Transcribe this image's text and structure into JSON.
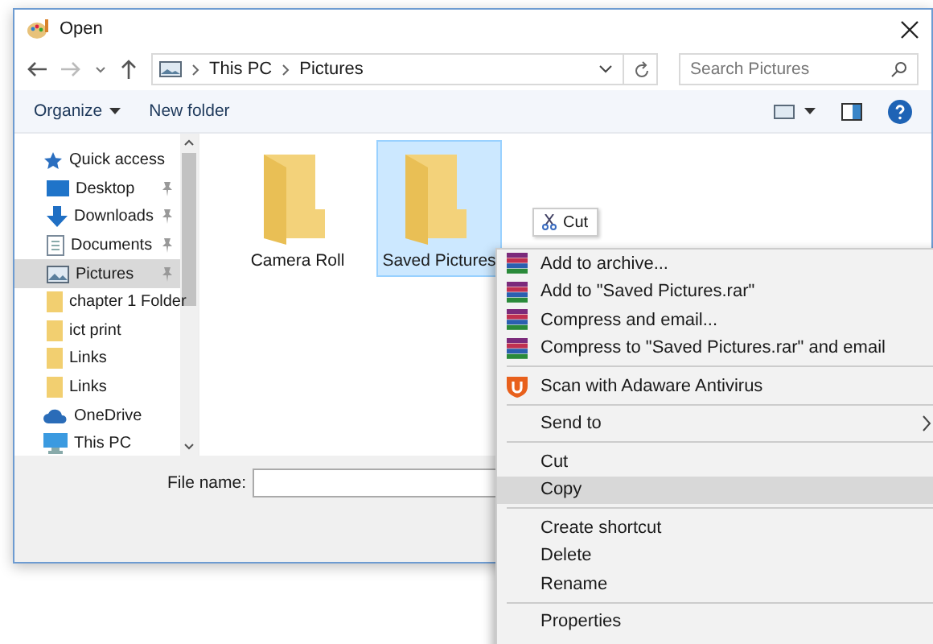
{
  "window": {
    "title": "Open"
  },
  "address": {
    "crumbs": [
      "This PC",
      "Pictures"
    ]
  },
  "search": {
    "placeholder": "Search Pictures"
  },
  "toolbar": {
    "organize": "Organize",
    "new_folder": "New folder"
  },
  "sidebar": {
    "items": [
      {
        "label": "Quick access",
        "kind": "star",
        "selected": false,
        "children": [
          {
            "label": "Desktop",
            "kind": "desktop",
            "pinned": true,
            "selected": false
          },
          {
            "label": "Downloads",
            "kind": "download",
            "pinned": true,
            "selected": false
          },
          {
            "label": "Documents",
            "kind": "document",
            "pinned": true,
            "selected": false
          },
          {
            "label": "Pictures",
            "kind": "pictures",
            "pinned": true,
            "selected": true
          },
          {
            "label": "chapter 1 Folder",
            "kind": "folder",
            "pinned": false,
            "selected": false
          },
          {
            "label": "ict print",
            "kind": "folder",
            "pinned": false,
            "selected": false
          },
          {
            "label": "Links",
            "kind": "folder",
            "pinned": false,
            "selected": false
          },
          {
            "label": "Links",
            "kind": "folder",
            "pinned": false,
            "selected": false
          }
        ]
      },
      {
        "label": "OneDrive",
        "kind": "cloud",
        "selected": false
      },
      {
        "label": "This PC",
        "kind": "pc",
        "selected": false
      }
    ]
  },
  "folders": [
    {
      "name": "Camera Roll",
      "selected": false
    },
    {
      "name": "Saved Pictures",
      "selected": true
    }
  ],
  "tooltip": {
    "label": "Cut"
  },
  "file_name": {
    "label": "File name:"
  },
  "context_menu": {
    "groups": [
      [
        {
          "label": "Add to archive...",
          "kind": "archive",
          "selected": false
        },
        {
          "label": "Add to \"Saved Pictures.rar\"",
          "kind": "archive",
          "selected": false
        },
        {
          "label": "Compress and email...",
          "kind": "archive",
          "selected": false
        },
        {
          "label": "Compress to \"Saved Pictures.rar\" and email",
          "kind": "archive",
          "selected": false
        }
      ],
      [
        {
          "label": "Scan with Adaware Antivirus",
          "kind": "shield",
          "selected": false
        }
      ],
      [
        {
          "label": "Send to",
          "kind": "submenu",
          "selected": false
        }
      ],
      [
        {
          "label": "Cut",
          "kind": "plain",
          "selected": false
        },
        {
          "label": "Copy",
          "kind": "plain",
          "selected": true
        }
      ],
      [
        {
          "label": "Create shortcut",
          "kind": "plain",
          "selected": false
        },
        {
          "label": "Delete",
          "kind": "plain",
          "selected": false
        },
        {
          "label": "Rename",
          "kind": "plain",
          "selected": false
        }
      ],
      [
        {
          "label": "Properties",
          "kind": "plain",
          "selected": false
        }
      ]
    ]
  }
}
